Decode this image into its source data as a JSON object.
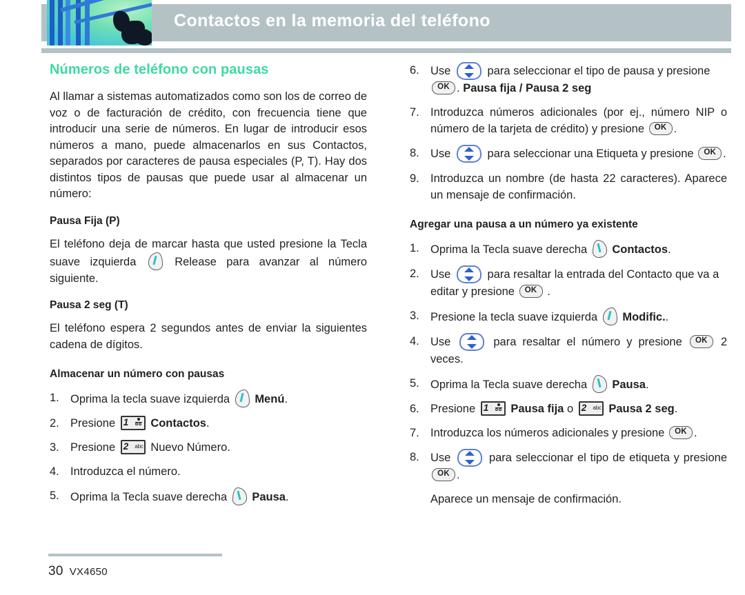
{
  "header": {
    "title": "Contactos en la memoria del teléfono",
    "bar_color": "#b4c2c6",
    "title_color": "#ffffff"
  },
  "left_column": {
    "section_title": "Números de teléfono con pausas",
    "section_title_color": "#3ed9a0",
    "intro_paragraph": "Al llamar a sistemas automatizados como son los de correo de voz o de facturación de crédito, con frecuencia tiene que introducir una serie de números. En lugar de introducir esos números a mano, puede almacenarlos en sus Contactos, separados por caracteres de pausa especiales (P, T). Hay dos distintos tipos de pausas que puede usar al almacenar un número:",
    "pausa_fija": {
      "heading": "Pausa Fija (P)",
      "text_before_icon": "El teléfono deja de marcar hasta que usted presione la Tecla suave izquierda",
      "icon": "left-softkey-icon",
      "text_after_icon": "Release para avanzar al número siguiente."
    },
    "pausa_2seg": {
      "heading": "Pausa 2 seg (T)",
      "text": "El teléfono espera 2 segundos antes de enviar la siguientes cadena de dígitos."
    },
    "almacenar": {
      "heading": "Almacenar un número con pausas",
      "steps": [
        {
          "num": "1.",
          "before": "Oprima la tecla suave izquierda",
          "icon": "left-softkey-icon",
          "bold": "Menú",
          "after": "."
        },
        {
          "num": "2.",
          "before": "Presione",
          "icon": "key-1-voicemail-icon",
          "bold": "Contactos",
          "after": "."
        },
        {
          "num": "3.",
          "before": "Presione",
          "icon": "key-2-abc-icon",
          "plain": "Nuevo Número",
          "after": "."
        },
        {
          "num": "4.",
          "before": "Introduzca el número.",
          "icon": null
        },
        {
          "num": "5.",
          "before": "Oprima la Tecla suave derecha",
          "icon": "right-softkey-icon",
          "bold": "Pausa",
          "after": "."
        }
      ]
    }
  },
  "right_column": {
    "continued_steps": [
      {
        "num": "6.",
        "seg1": "Use",
        "icon1": "nav-updown-icon",
        "seg2": "para seleccionar el tipo de pausa y presione",
        "icon2": "ok-key-icon",
        "seg3": ".",
        "bold": "Pausa fija / Pausa 2 seg"
      },
      {
        "num": "7.",
        "seg1": "Introduzca números adicionales (por ej., número NIP o número de la tarjeta de crédito) y presione",
        "icon1": "ok-key-icon",
        "seg2": "."
      },
      {
        "num": "8.",
        "seg1": "Use",
        "icon1": "nav-updown-icon",
        "seg2": "para seleccionar una Etiqueta y presione",
        "icon2": "ok-key-icon",
        "seg3": "."
      },
      {
        "num": "9.",
        "seg1": "Introduzca un nombre (de hasta 22 caracteres). Aparece un mensaje de confirmación."
      }
    ],
    "agregar": {
      "heading": "Agregar una pausa a un número ya existente",
      "steps": [
        {
          "num": "1.",
          "seg1": "Oprima la Tecla suave derecha",
          "icon1": "right-softkey-icon",
          "bold": "Contactos",
          "seg2": "."
        },
        {
          "num": "2.",
          "seg1": "Use",
          "icon1": "nav-updown-icon",
          "seg2": "para resaltar la entrada del Contacto que va a editar y presione",
          "icon2": "ok-key-icon",
          "seg3": "."
        },
        {
          "num": "3.",
          "seg1": "Presione la tecla suave izquierda",
          "icon1": "left-softkey-icon",
          "bold": "Modific.",
          "seg2": "."
        },
        {
          "num": "4.",
          "seg1": "Use",
          "icon1": "nav-updown-icon",
          "seg2": "para resaltar el número y presione",
          "icon2": "ok-key-icon",
          "seg3": "2 veces."
        },
        {
          "num": "5.",
          "seg1": "Oprima la Tecla suave derecha",
          "icon1": "right-softkey-icon",
          "bold": "Pausa",
          "seg2": "."
        },
        {
          "num": "6.",
          "seg1": "Presione",
          "icon1": "key-1-voicemail-icon",
          "bold1": "Pausa fija",
          "seg2": "o",
          "icon2": "key-2-abc-icon",
          "bold2": "Pausa 2 seg",
          "seg3": "."
        },
        {
          "num": "7.",
          "seg1": "Introduzca los números adicionales y presione",
          "icon1": "ok-key-icon",
          "seg2": "."
        },
        {
          "num": "8.",
          "seg1": "Use",
          "icon1": "nav-updown-icon",
          "seg2": "para seleccionar el tipo de etiqueta y presione",
          "icon2": "ok-key-icon",
          "seg3": "."
        }
      ],
      "closing_note": "Aparece un mensaje de confirmación."
    }
  },
  "keys": {
    "ok_label": "OK",
    "key1_digit": "1",
    "key2_digit": "2",
    "key2_letters": "abc"
  },
  "footer": {
    "page_number": "30",
    "model": "VX4650"
  }
}
